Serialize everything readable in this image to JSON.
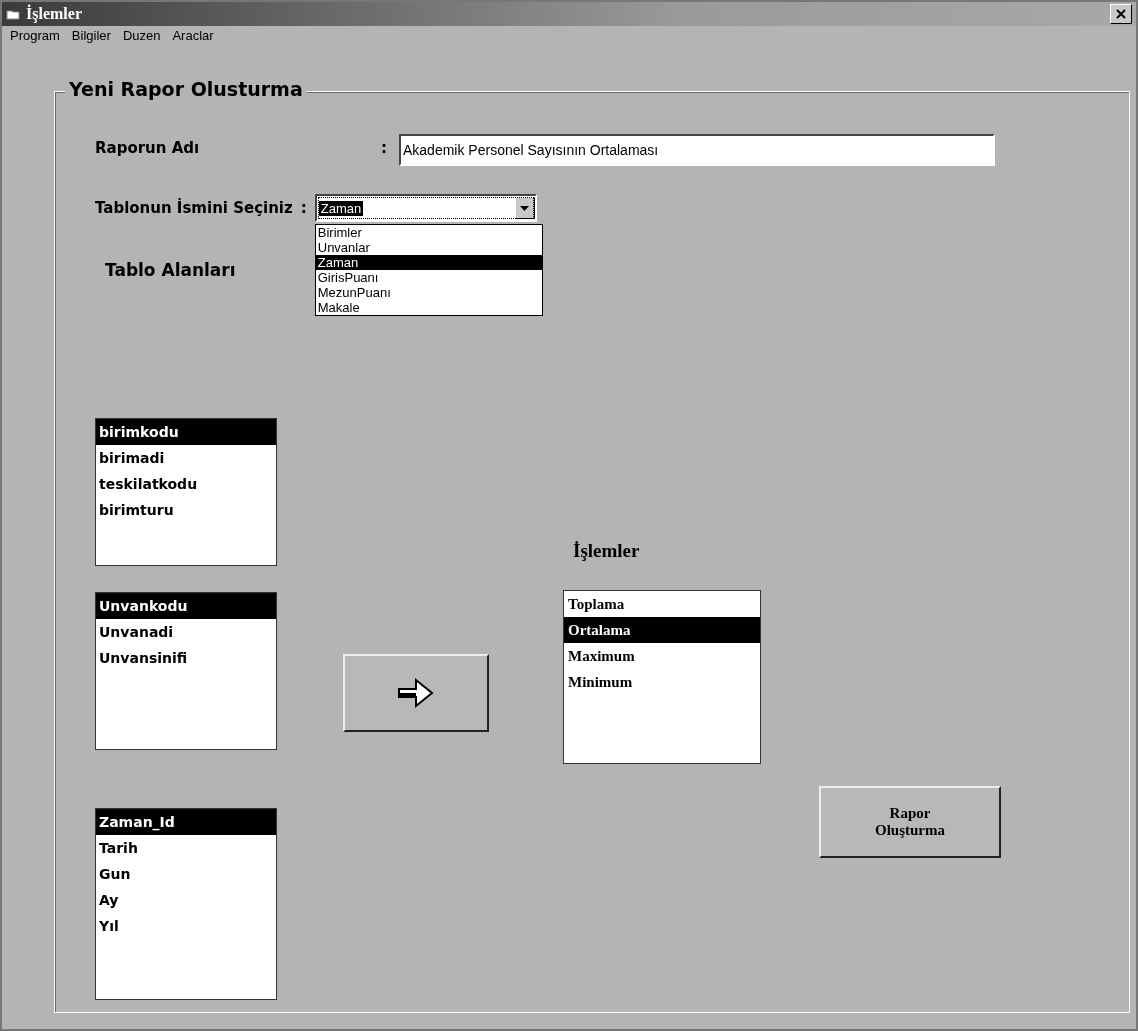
{
  "window": {
    "title": "İşlemler"
  },
  "menu": [
    "Program",
    "Bilgiler",
    "Duzen",
    "Araclar"
  ],
  "group": {
    "title": "Yeni Rapor Olusturma"
  },
  "report_name": {
    "label": "Raporun Adı",
    "colon": ":",
    "value": "Akademik Personel Sayısının Ortalaması"
  },
  "table_select": {
    "label": "Tablonun İsmini Seçiniz",
    "colon": ":",
    "value": "Zaman",
    "expanded": true,
    "options": [
      {
        "label": "Birimler",
        "selected": false
      },
      {
        "label": "Unvanlar",
        "selected": false
      },
      {
        "label": "Zaman",
        "selected": true
      },
      {
        "label": "GirisPuanı",
        "selected": false
      },
      {
        "label": "MezunPuanı",
        "selected": false
      },
      {
        "label": "Makale",
        "selected": false
      }
    ]
  },
  "fields_label": "Tablo Alanları",
  "field_lists": [
    {
      "items": [
        {
          "label": "birimkodu",
          "selected": true
        },
        {
          "label": "birimadi",
          "selected": false
        },
        {
          "label": "teskilatkodu",
          "selected": false
        },
        {
          "label": "birimturu",
          "selected": false
        }
      ]
    },
    {
      "items": [
        {
          "label": "Unvankodu",
          "selected": true
        },
        {
          "label": "Unvanadi",
          "selected": false
        },
        {
          "label": "Unvansinifi",
          "selected": false
        }
      ]
    },
    {
      "items": [
        {
          "label": "Zaman_Id",
          "selected": true
        },
        {
          "label": "Tarih",
          "selected": false
        },
        {
          "label": "Gun",
          "selected": false
        },
        {
          "label": "Ay",
          "selected": false
        },
        {
          "label": "Yıl",
          "selected": false
        }
      ]
    }
  ],
  "operations": {
    "label": "İşlemler",
    "items": [
      {
        "label": "Toplama",
        "selected": false
      },
      {
        "label": "Ortalama",
        "selected": true
      },
      {
        "label": "Maximum",
        "selected": false
      },
      {
        "label": "Minimum",
        "selected": false
      }
    ]
  },
  "create_button": "Rapor Oluşturma"
}
